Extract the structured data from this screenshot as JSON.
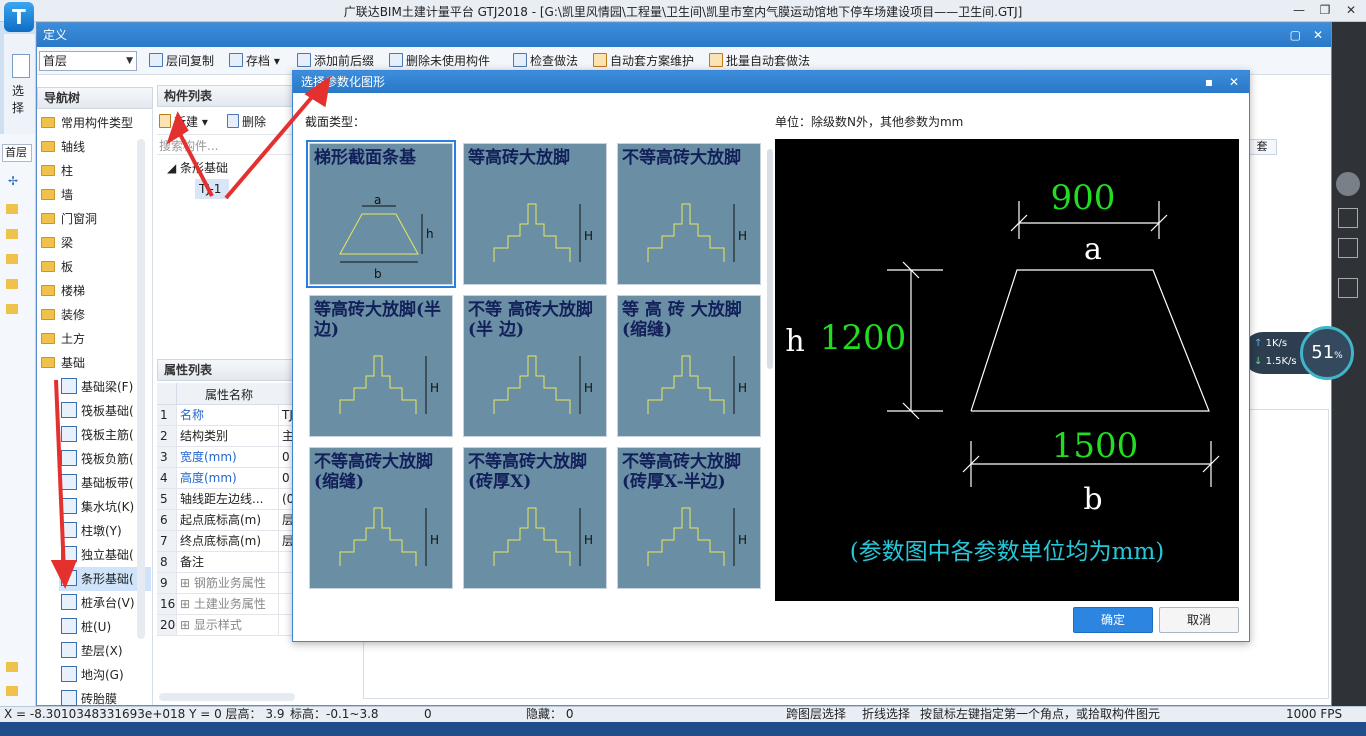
{
  "app": {
    "title": "广联达BIM土建计量平台 GTJ2018 - [G:\\凯里风情园\\工程量\\卫生间\\凯里市室内气膜运动馆地下停车场建设项目——卫生间.GTJ]",
    "logo": "T",
    "left_label": "选择"
  },
  "define_window": {
    "title": "定义",
    "floor": "首层",
    "toolbar": [
      "层间复制",
      "存档",
      "添加前后缀",
      "删除未使用构件",
      "检查做法",
      "自动套方案维护",
      "批量自动套做法"
    ],
    "nav_title": "导航树",
    "nav_items": [
      "常用构件类型",
      "轴线",
      "柱",
      "墙",
      "门窗洞",
      "梁",
      "板",
      "楼梯",
      "装修",
      "土方",
      "基础"
    ],
    "nav_sub_items": [
      "基础梁(F)",
      "筏板基础(",
      "筏板主筋(",
      "筏板负筋(",
      "基础板带(",
      "集水坑(K)",
      "柱墩(Y)",
      "独立基础(",
      "条形基础(",
      "桩承台(V)",
      "桩(U)",
      "垫层(X)",
      "地沟(G)",
      "砖胎膜"
    ],
    "comp_list_title": "构件列表",
    "comp_toolbar": {
      "new": "新建",
      "delete": "删除"
    },
    "search_placeholder": "搜索构件...",
    "tree_root": "条形基础",
    "tree_child": "TJ-1",
    "prop_title": "属性列表",
    "prop_header": "属性名称",
    "props": [
      {
        "no": "1",
        "name": "名称",
        "val": "TJ",
        "blue": true
      },
      {
        "no": "2",
        "name": "结构类别",
        "val": "主",
        "blue": false
      },
      {
        "no": "3",
        "name": "宽度(mm)",
        "val": "0",
        "blue": true
      },
      {
        "no": "4",
        "name": "高度(mm)",
        "val": "0",
        "blue": true
      },
      {
        "no": "5",
        "name": "轴线距左边线...",
        "val": "(0",
        "blue": false
      },
      {
        "no": "6",
        "name": "起点底标高(m)",
        "val": "层",
        "blue": false
      },
      {
        "no": "7",
        "name": "终点底标高(m)",
        "val": "层",
        "blue": false
      },
      {
        "no": "8",
        "name": "备注",
        "val": "",
        "blue": false
      },
      {
        "no": "9",
        "name": "钢筋业务属性",
        "val": "",
        "blue": false,
        "group": true
      },
      {
        "no": "16",
        "name": "土建业务属性",
        "val": "",
        "blue": false,
        "group": true
      },
      {
        "no": "20",
        "name": "显示样式",
        "val": "",
        "blue": false,
        "group": true
      }
    ],
    "side_tab": "首层",
    "right_tab": "套"
  },
  "dialog": {
    "title": "选择参数化图形",
    "section_label": "截面类型：",
    "unit_label": "单位：除级数N外，其他参数为mm",
    "thumbs": [
      "梯形截面条基",
      "等高砖大放脚",
      "不等高砖大放脚",
      "等高砖大放脚(半边)",
      "不等 高砖大放脚(半 边)",
      "等 高 砖 大放脚(缩缝)",
      "不等高砖大放脚(缩缝)",
      "不等高砖大放脚(砖厚X)",
      "不等高砖大放脚(砖厚X-半边)"
    ],
    "preview": {
      "a_value": "900",
      "a_label": "a",
      "h_value": "1200",
      "h_label": "h",
      "b_value": "1500",
      "b_label": "b",
      "note": "(参数图中各参数单位均为mm)"
    },
    "ok": "确定",
    "cancel": "取消"
  },
  "status": {
    "coords": "X = -8.3010348331693e+018 Y = 0 层高：  3.9",
    "elev": "标高：-0.1~3.8",
    "zero": "0",
    "hidden": "隐藏：  0",
    "cross": "跨图层选择",
    "poly": "折线选择",
    "hint": "按鼠标左键指定第一个角点，或拾取构件图元",
    "fps": "1000 FPS"
  },
  "net_widget": {
    "up": "1K/s",
    "down": "1.5K/s",
    "pct": "51"
  }
}
